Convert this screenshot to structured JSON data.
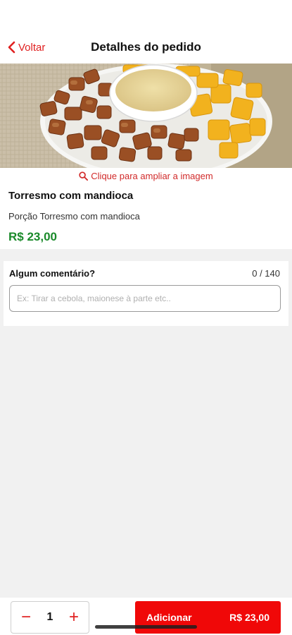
{
  "header": {
    "back_label": "Voltar",
    "title": "Detalhes do pedido"
  },
  "product": {
    "zoom_hint": "Clique para ampliar a imagem",
    "name": "Torresmo com mandioca",
    "description": "Porção Torresmo com mandioca",
    "price": "R$ 23,00"
  },
  "comment": {
    "label": "Algum comentário?",
    "counter": "0 / 140",
    "placeholder": "Ex: Tirar a cebola, maionese à parte etc..",
    "value": ""
  },
  "order_bar": {
    "decrement_symbol": "−",
    "quantity": "1",
    "increment_symbol": "+",
    "add_label": "Adicionar",
    "add_price": "R$ 23,00"
  },
  "icons": {
    "back": "chevron-left-icon",
    "zoom": "magnifier-icon"
  },
  "colors": {
    "accent_red": "#e02020",
    "button_red": "#f00808",
    "price_green": "#1a8a2a",
    "background": "#f1f1f1"
  }
}
